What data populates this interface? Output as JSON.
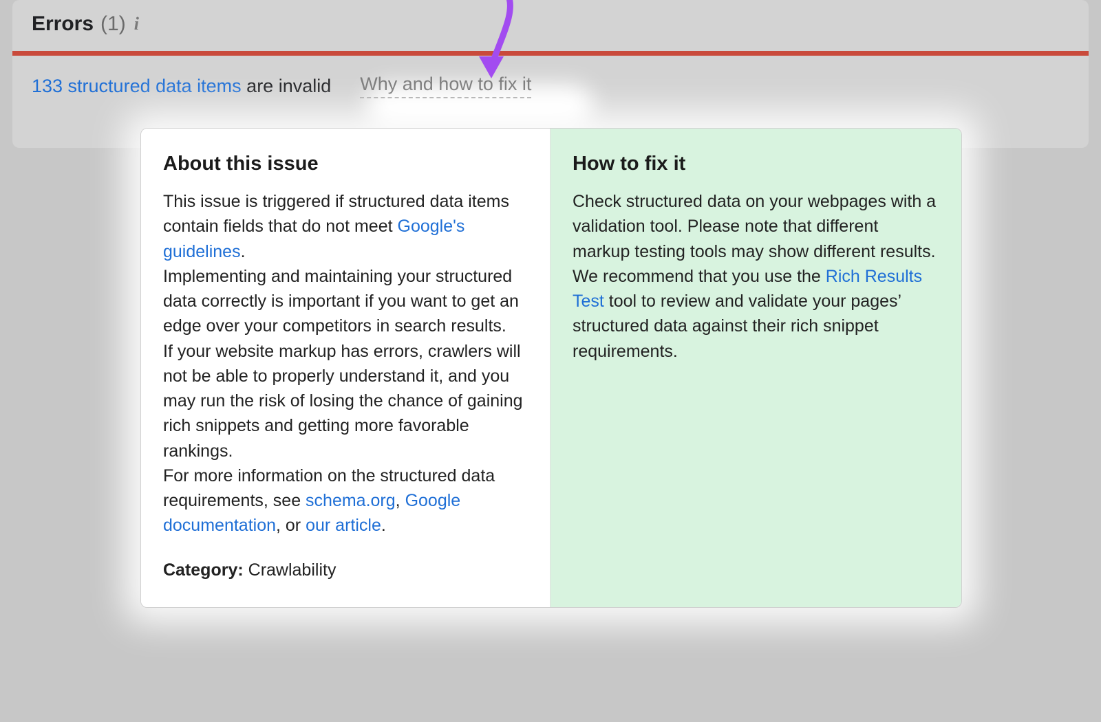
{
  "errors_header": {
    "label": "Errors",
    "count": "(1)"
  },
  "issue": {
    "count_link": "133 structured data items",
    "suffix": " are invalid",
    "why_link": "Why and how to fix it"
  },
  "popover": {
    "about": {
      "title": "About this issue",
      "p1_a": "This issue is triggered if structured data items contain fields that do not meet ",
      "p1_link1": "Google's guidelines",
      "p1_b": ".",
      "p2": "Implementing and maintaining your structured data correctly is important if you want to get an edge over your competitors in search results.",
      "p3": "If your website markup has errors, crawlers will not be able to properly understand it, and you may run the risk of losing the chance of gaining rich snippets and getting more favorable rankings.",
      "p4_a": "For more information on the structured data requirements, see ",
      "p4_link1": "schema.org",
      "p4_b": ", ",
      "p4_link2": "Google documentation",
      "p4_c": ", or ",
      "p4_link3": "our article",
      "p4_d": ".",
      "category_label": "Category:",
      "category_value": " Crawlability"
    },
    "fix": {
      "title": "How to fix it",
      "p1": "Check structured data on your webpages with a validation tool. Please note that different markup testing tools may show different results.",
      "p2_a": "We recommend that you use the ",
      "p2_link1": "Rich Results Test",
      "p2_b": " tool to review and validate your pages’ structured data against their rich snippet requirements."
    }
  }
}
